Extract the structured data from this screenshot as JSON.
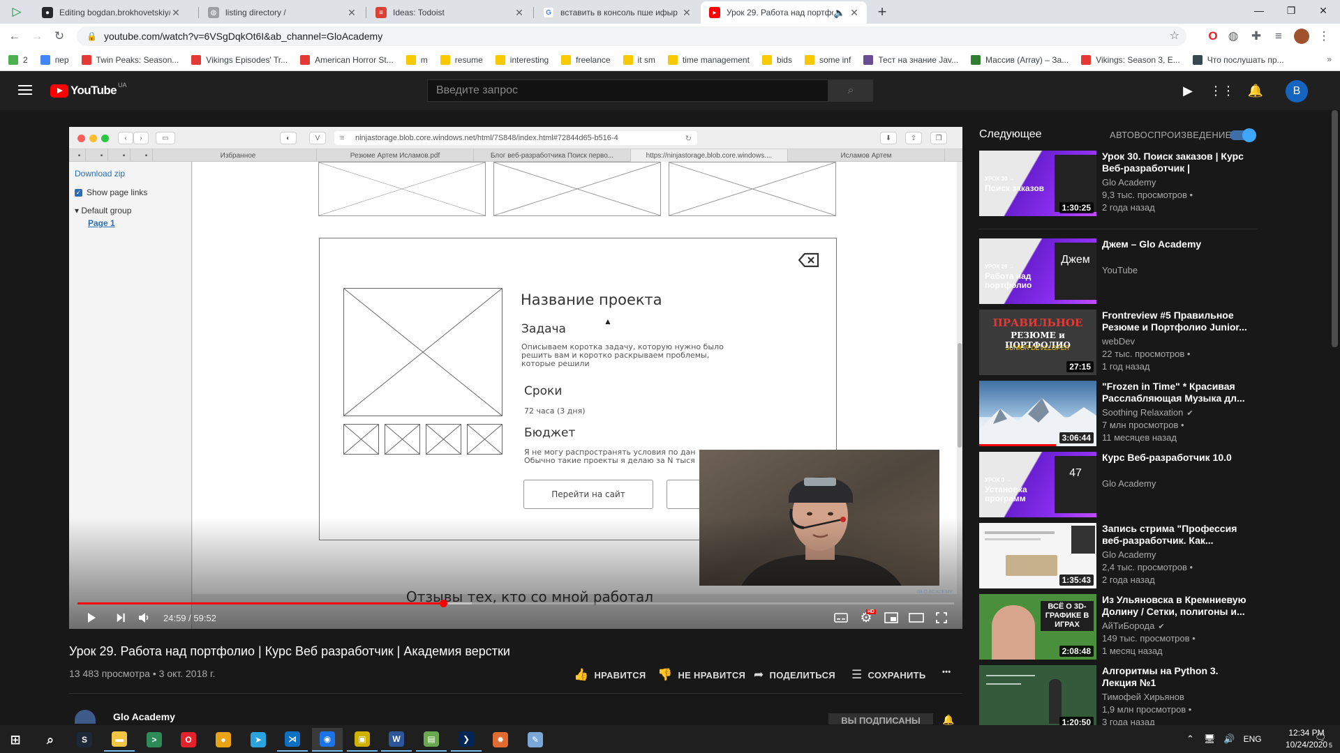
{
  "browser": {
    "tabs": [
      {
        "title": "Editing bogdan.brokhovetskiy/RE",
        "icon": "github-icon",
        "color": "#24292e"
      },
      {
        "title": "listing directory /",
        "icon": "globe-icon",
        "color": "#5f6368"
      },
      {
        "title": "Ideas: Todoist",
        "icon": "todoist-icon",
        "color": "#db4035"
      },
      {
        "title": "вставить в консоль пше ифыр",
        "icon": "google-icon",
        "color": "#4285f4"
      },
      {
        "title": "Урок 29. Работа над портфо",
        "icon": "youtube-icon",
        "color": "#ff0000"
      }
    ],
    "new_tab_label": "+",
    "url": "youtube.com/watch?v=6VSgDqkOt6I&ab_channel=GloAcademy",
    "bookmarks": [
      {
        "label": "2",
        "color": "#4caf50"
      },
      {
        "label": "пер",
        "color": "#4285f4"
      },
      {
        "label": "Twin Peaks: Season...",
        "color": "#e53935"
      },
      {
        "label": "Vikings Episodes' Tr...",
        "color": "#e53935"
      },
      {
        "label": "American Horror St...",
        "color": "#e53935"
      },
      {
        "label": "m",
        "color": "#f9c900"
      },
      {
        "label": "resume",
        "color": "#f9c900"
      },
      {
        "label": "interesting",
        "color": "#f9c900"
      },
      {
        "label": "freelance",
        "color": "#f9c900"
      },
      {
        "label": "it sm",
        "color": "#f9c900"
      },
      {
        "label": "time management",
        "color": "#f9c900"
      },
      {
        "label": "bids",
        "color": "#f9c900"
      },
      {
        "label": "some inf",
        "color": "#f9c900"
      },
      {
        "label": "Тест на знание Jav...",
        "color": "#6a4c93"
      },
      {
        "label": "Массив (Array) – За...",
        "color": "#2e7d32"
      },
      {
        "label": "Vikings: Season 3, E...",
        "color": "#e53935"
      },
      {
        "label": "Что послушать пр...",
        "color": "#37474f"
      }
    ],
    "more_bookmarks": "»"
  },
  "youtube": {
    "logo_text": "YouTube",
    "region": "UA",
    "search_placeholder": "Введите запрос",
    "user_initial": "B"
  },
  "mac_window": {
    "url": "ninjastorage.blob.core.windows.net/html/7S848/index.html#72844d65-b516-4",
    "tabs": [
      "Избранное",
      "Резюме Артем Исламов.pdf",
      "Блог веб-разработчика Поиск перво...",
      "https://ninjastorage.blob.core.windows....",
      "Исламов Артем"
    ],
    "download_zip": "Download zip",
    "show_page_links": "Show page links",
    "default_group": "Default group",
    "page_1": "Page 1"
  },
  "wireframe": {
    "project_title": "Название проекта",
    "task_heading": "Задача",
    "task_text": "Описываем коротка задачу, которую нужно было решить вам и коротко раскрываем проблемы, которые решили",
    "deadline_heading": "Сроки",
    "deadline_text": "72 часа (3 дня)",
    "budget_heading": "Бюджет",
    "budget_text_1": "Я не могу распространять условия по дан",
    "budget_text_2": "Обычно такие проекты я делаю за N тыся",
    "go_to_site": "Перейти на сайт",
    "close_icon": "backspace-icon"
  },
  "player": {
    "subtitle": "Отзывы тех, кто со мной работал",
    "time_current": "24:59",
    "time_sep": " / ",
    "time_total": "59:52",
    "progress": 0.4173,
    "buffered": 0.45,
    "watermark": "GLO ACADEMY"
  },
  "video": {
    "title": "Урок 29. Работа над портфолио | Курс Веб разработчик | Академия верстки",
    "views": "13 483 просмотра",
    "date_sep": " • ",
    "date": "3 окт. 2018 г.",
    "like_label": "НРАВИТСЯ",
    "dislike_label": "НЕ НРАВИТСЯ",
    "share_label": "ПОДЕЛИТЬСЯ",
    "save_label": "СОХРАНИТЬ",
    "more_label": "•••",
    "channel": "Glo Academy",
    "subscribed_label": "ВЫ ПОДПИСАНЫ"
  },
  "sidebar": {
    "up_next": "Следующее",
    "autoplay": "АВТОВОСПРОИЗВЕДЕНИЕ",
    "autoplay_on": true,
    "items": [
      {
        "title": "Урок 30. Поиск заказов | Курс Веб-разработчик | Академия...",
        "channel": "Glo Academy",
        "views": "9,3 тыс. просмотров •",
        "age": "2 года назад",
        "duration": "1:30:25",
        "thumb_caption": "Поиск заказов",
        "thumb_sub": "УРОК 30 →",
        "theme": "purple"
      },
      {
        "title": "Джем – Glo Academy",
        "channel": "YouTube",
        "views": "",
        "age": "",
        "duration": "",
        "thumb_caption": "Работа над портфолио",
        "thumb_sub": "УРОК 29 →",
        "thumb_overlay": "Джем",
        "theme": "purple"
      },
      {
        "title": "Frontreview #5 Правильное Резюме и Портфолио Junior...",
        "channel": "webDev",
        "views": "22 тыс. просмотров •",
        "age": "1 год назад",
        "duration": "27:15",
        "thumb_caption": "ПРАВИЛЬНОЕ",
        "thumb_sub": "РЕЗЮМЕ и ПОРТФОЛИО",
        "thumb_overlay": "JUNIOR DEVELOPER",
        "theme": "dark-red"
      },
      {
        "title": "\"Frozen in Time\" * Красивая Расслабляющая Музыка дл...",
        "channel": "Soothing Relaxation",
        "verified": true,
        "views": "7 млн просмотров •",
        "age": "11 месяцев назад",
        "duration": "3:06:44",
        "theme": "mountain"
      },
      {
        "title": "Курс Веб-разработчик 10.0",
        "channel": "Glo Academy",
        "views": "",
        "age": "",
        "duration": "",
        "thumb_caption": "Установка программ",
        "thumb_sub": "УРОК 0 →",
        "thumb_overlay": "47",
        "theme": "purple"
      },
      {
        "title": "Запись стрима \"Профессия веб-разработчик. Как...",
        "channel": "Glo Academy",
        "views": "2,4 тыс. просмотров •",
        "age": "2 года назад",
        "duration": "1:35:43",
        "theme": "white"
      },
      {
        "title": "Из Ульяновска в Кремниевую Долину / Сетки, полигоны и...",
        "channel": "АйТиБорода",
        "verified": true,
        "views": "149 тыс. просмотров •",
        "age": "1 месяц назад",
        "duration": "2:08:48",
        "thumb_caption": "ВСЁ О 3D-ГРАФИКЕ В ИГРАХ",
        "theme": "green"
      },
      {
        "title": "Алгоритмы на Python 3. Лекция №1",
        "channel": "Тимофей Хирьянов",
        "views": "1,9 млн просмотров •",
        "age": "3 года назад",
        "duration": "1:20:50",
        "theme": "board"
      }
    ]
  },
  "taskbar": {
    "apps": [
      {
        "name": "windows-start-icon",
        "color": "#ffffff",
        "glyph": "⊞"
      },
      {
        "name": "search-icon",
        "color": "#ffffff",
        "glyph": "⌕"
      },
      {
        "name": "steam-icon",
        "color": "#1b2838",
        "glyph": "S"
      },
      {
        "name": "file-explorer-icon",
        "color": "#f4c542",
        "glyph": "▬"
      },
      {
        "name": "terminal-icon",
        "color": "#2e8b57",
        "glyph": ">"
      },
      {
        "name": "opera-icon",
        "color": "#e3222b",
        "glyph": "O"
      },
      {
        "name": "chrome-canary-icon",
        "color": "#e8a317",
        "glyph": "●"
      },
      {
        "name": "telegram-icon",
        "color": "#2aa3df",
        "glyph": "➤"
      },
      {
        "name": "vscode-icon",
        "color": "#0e70c0",
        "glyph": "⋊"
      },
      {
        "name": "chrome-icon",
        "color": "#1a73e8",
        "glyph": "◉"
      },
      {
        "name": "photo-app-icon",
        "color": "#d0b100",
        "glyph": "▣"
      },
      {
        "name": "word-icon",
        "color": "#2b579a",
        "glyph": "W"
      },
      {
        "name": "notepad-icon",
        "color": "#6aa84f",
        "glyph": "▤"
      },
      {
        "name": "powershell-icon",
        "color": "#012456",
        "glyph": "❯"
      },
      {
        "name": "settings-app-icon",
        "color": "#e06c2f",
        "glyph": "✹"
      },
      {
        "name": "paint-icon",
        "color": "#7aa7d8",
        "glyph": "✎"
      }
    ],
    "language": "ENG",
    "time": "12:34 PM",
    "date": "10/24/2020",
    "notifications": "5"
  }
}
